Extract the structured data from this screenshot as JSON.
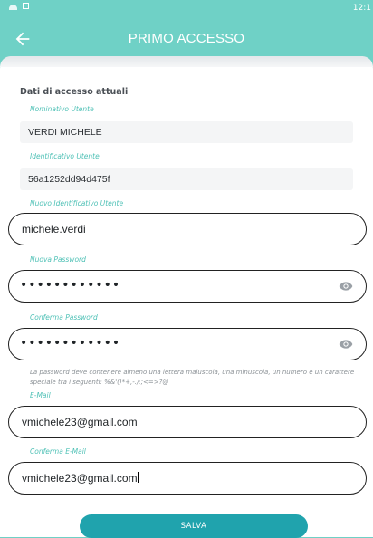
{
  "status_bar": {
    "time": "12:1"
  },
  "header": {
    "title": "PRIMO ACCESSO"
  },
  "section": {
    "title": "Dati di accesso attuali"
  },
  "fields": {
    "current_name": {
      "label": "Nominativo Utente",
      "value": "VERDI MICHELE"
    },
    "current_id": {
      "label": "Identificativo Utente",
      "value": "56a1252dd94d475f"
    },
    "new_id": {
      "label": "Nuovo Identificativo Utente",
      "value": "michele.verdi"
    },
    "new_password": {
      "label": "Nuova Password",
      "value": "••••••••••••"
    },
    "confirm_password": {
      "label": "Conferma Password",
      "value": "••••••••••••"
    },
    "email": {
      "label": "E-Mail",
      "value": "vmichele23@gmail.com"
    },
    "confirm_email": {
      "label": "Conferma E-Mail",
      "value": "vmichele23@gmail.com"
    }
  },
  "password_hint": "La password deve contenere almeno una lettera maiuscola, una minuscola, un numero e un carattere speciale tra i seguenti: %&'()*+,-./:;<=>?@",
  "actions": {
    "save_label": "SALVA"
  },
  "icons": {
    "back": "arrow-left-icon",
    "reveal": "eye-icon"
  },
  "colors": {
    "header": "#6fd1c6",
    "accent": "#4fc1b6",
    "button": "#20a3ad"
  }
}
